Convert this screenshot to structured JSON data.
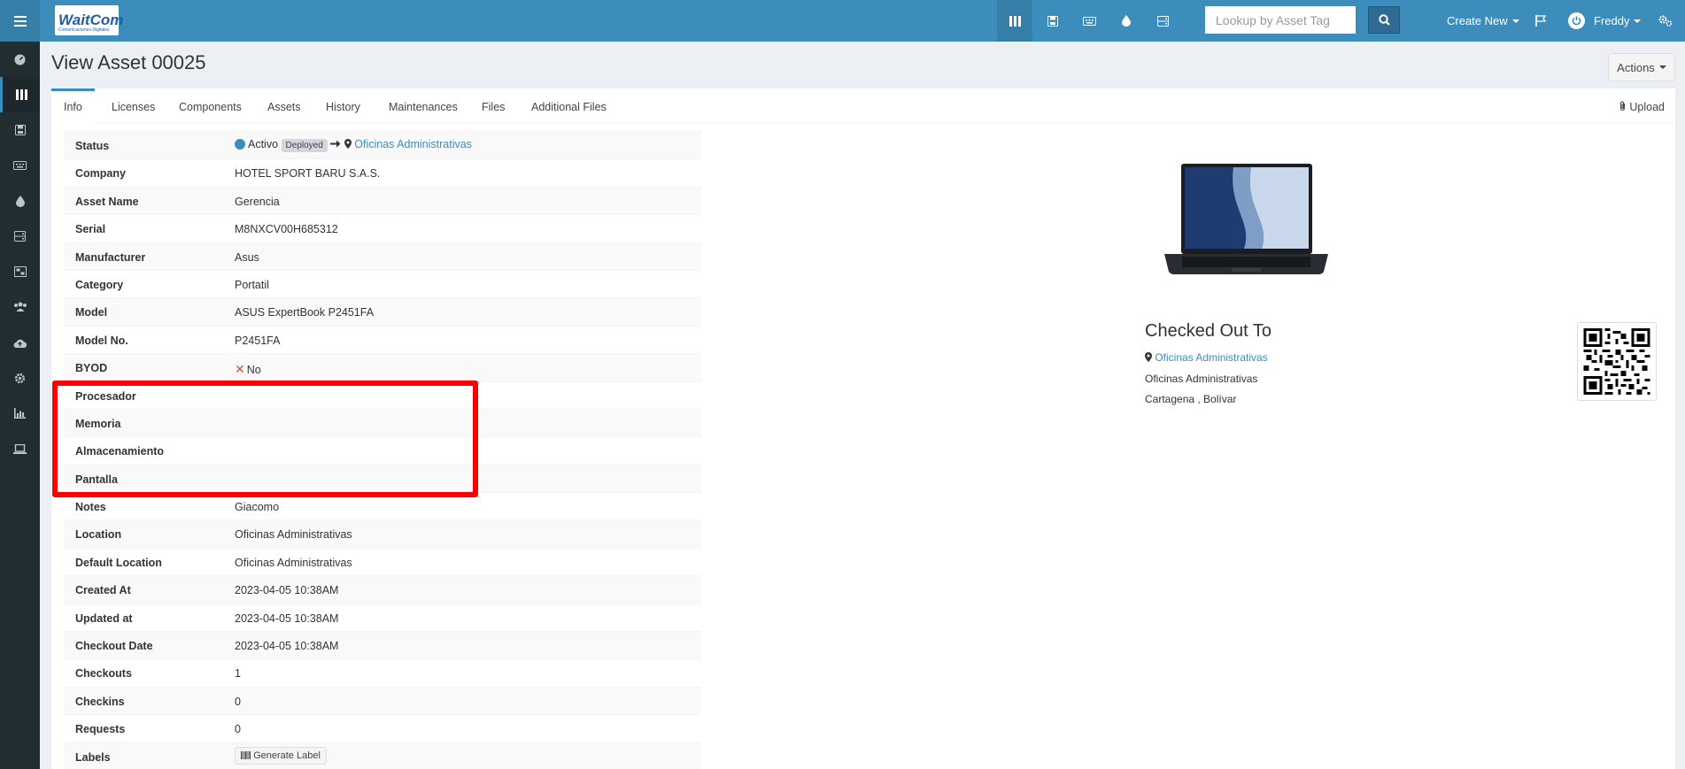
{
  "topbar": {
    "logo_text": "WaitCom",
    "logo_sub": "Comunicaciones Digitales",
    "search_placeholder": "Lookup by Asset Tag",
    "create_new": "Create New",
    "user_name": "Freddy",
    "icons": [
      "assets-icon",
      "licenses-icon",
      "accessories-icon",
      "consumables-icon",
      "components-icon",
      "search-icon",
      "flag-icon",
      "power-icon",
      "settings-icon"
    ]
  },
  "sidebar": {
    "icons": [
      "dashboard-icon",
      "assets-icon",
      "licenses-icon",
      "accessories-icon",
      "consumables-icon",
      "components-icon",
      "kits-icon",
      "users-icon",
      "import-icon",
      "settings-icon",
      "reports-icon",
      "laptop-icon"
    ]
  },
  "page": {
    "title": "View Asset 00025",
    "actions": "Actions"
  },
  "tabs": [
    "Info",
    "Licenses",
    "Components",
    "Assets",
    "History",
    "Maintenances",
    "Files",
    "Additional Files"
  ],
  "upload": "Upload",
  "status": {
    "label": "Status",
    "state": "Activo",
    "badge": "Deployed",
    "location": "Oficinas Administrativas"
  },
  "rows": [
    {
      "label": "Company",
      "value": "HOTEL SPORT BARU S.A.S.",
      "link": true
    },
    {
      "label": "Asset Name",
      "value": "Gerencia",
      "link": false
    },
    {
      "label": "Serial",
      "value": "M8NXCV00H685312",
      "link": false
    },
    {
      "label": "Manufacturer",
      "value": "Asus",
      "link": true
    },
    {
      "label": "Category",
      "value": "Portatil",
      "link": true
    },
    {
      "label": "Model",
      "value": "ASUS ExpertBook P2451FA",
      "link": true
    },
    {
      "label": "Model No.",
      "value": "P2451FA",
      "link": false
    }
  ],
  "byod": {
    "label": "BYOD",
    "value": "No"
  },
  "custom_rows": [
    {
      "label": "Procesador",
      "value": ""
    },
    {
      "label": "Memoria",
      "value": ""
    },
    {
      "label": "Almacenamiento",
      "value": ""
    },
    {
      "label": "Pantalla",
      "value": ""
    }
  ],
  "rows2": [
    {
      "label": "Notes",
      "value": "Giacomo",
      "link": false
    },
    {
      "label": "Location",
      "value": "Oficinas Administrativas",
      "link": true
    },
    {
      "label": "Default Location",
      "value": "Oficinas Administrativas",
      "link": true
    },
    {
      "label": "Created At",
      "value": "2023-04-05 10:38AM",
      "link": false
    },
    {
      "label": "Updated at",
      "value": "2023-04-05 10:38AM",
      "link": false
    },
    {
      "label": "Checkout Date",
      "value": "2023-04-05 10:38AM",
      "link": false
    },
    {
      "label": "Checkouts",
      "value": "1",
      "link": false
    },
    {
      "label": "Checkins",
      "value": "0",
      "link": false
    },
    {
      "label": "Requests",
      "value": "0",
      "link": false
    }
  ],
  "labels_row": {
    "label": "Labels",
    "button": "Generate Label"
  },
  "checked_out": {
    "title": "Checked Out To",
    "location_link": "Oficinas Administrativas",
    "line1": "Oficinas Administrativas",
    "line2": "Cartagena , Bolívar"
  },
  "colors": {
    "topbar": "#3c8dbc",
    "sidebar": "#222d32",
    "link": "#3c8dbc",
    "highlight": "#ff0000"
  }
}
